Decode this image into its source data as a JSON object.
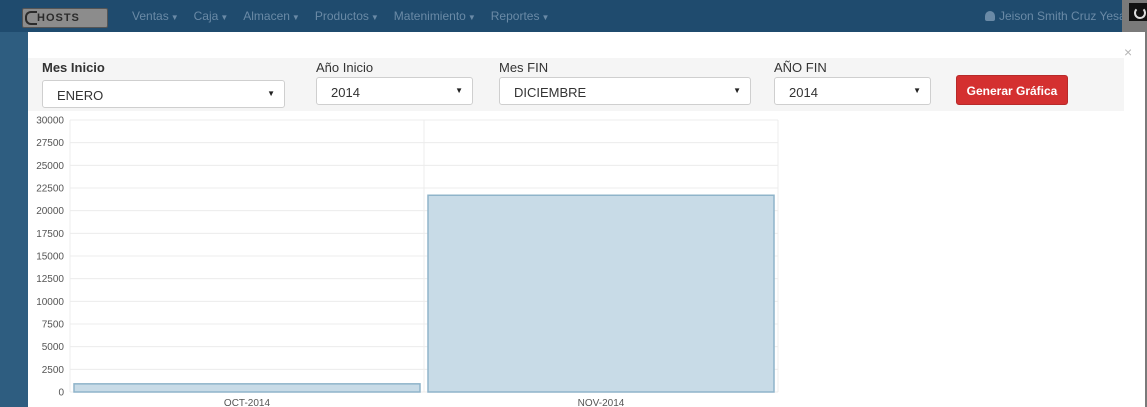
{
  "navbar": {
    "brand": "HOSTS",
    "menu": [
      {
        "label": "Ventas"
      },
      {
        "label": "Caja"
      },
      {
        "label": "Almacen"
      },
      {
        "label": "Productos"
      },
      {
        "label": "Matenimiento"
      },
      {
        "label": "Reportes"
      }
    ],
    "user": "Jeison Smith Cruz Yesan"
  },
  "modal": {
    "close_glyph": "×",
    "form": {
      "mes_inicio": {
        "label": "Mes Inicio",
        "value": "ENERO"
      },
      "anio_inicio": {
        "label": "Año Inicio",
        "value": "2014"
      },
      "mes_fin": {
        "label": "Mes FIN",
        "value": "DICIEMBRE"
      },
      "anio_fin": {
        "label": "AÑO FIN",
        "value": "2014"
      },
      "generate_label": "Generar Gráfica"
    }
  },
  "colors": {
    "bar_fill": "#c8dbe7",
    "bar_stroke": "#8fb4ca",
    "grid": "#ececec",
    "button": "#d43030"
  },
  "chart_data": {
    "type": "bar",
    "categories": [
      "OCT-2014",
      "NOV-2014"
    ],
    "values": [
      900,
      21700
    ],
    "ylim": [
      0,
      30000
    ],
    "yticks": [
      0,
      2500,
      5000,
      7500,
      10000,
      12500,
      15000,
      17500,
      20000,
      22500,
      25000,
      27500,
      30000
    ],
    "grid": true
  }
}
